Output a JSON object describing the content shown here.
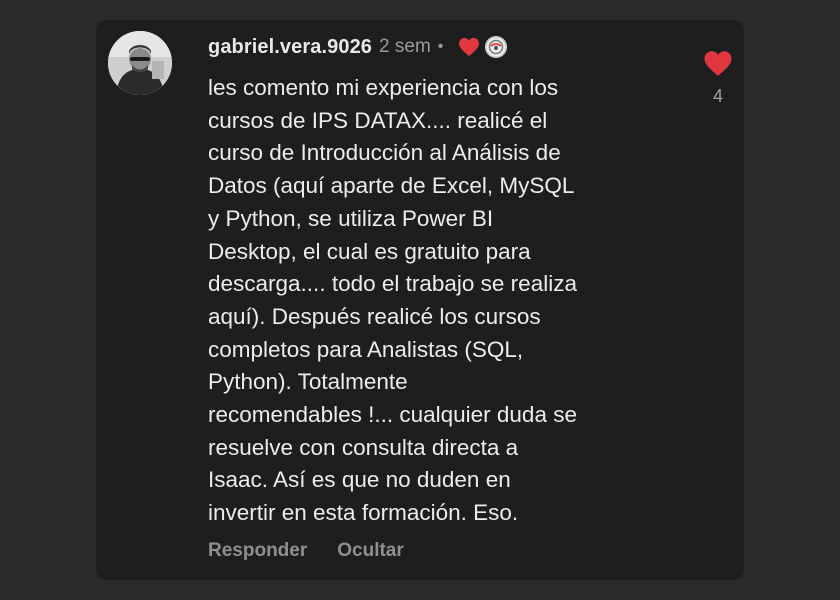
{
  "comment": {
    "username": "gabriel.vera.9026",
    "time_ago": "2 sem",
    "separator": "•",
    "avatar_icon": "user-avatar",
    "creator_liked_icon": "heart-icon",
    "creator_avatar_icon": "creator-avatar",
    "body_lines": [
      "les comento mi experiencia con los",
      "cursos de IPS DATAX.... realicé el",
      "curso de Introducción al Análisis de",
      "Datos (aquí aparte de Excel, MySQL",
      "y Python, se utiliza Power BI",
      "Desktop, el cual es gratuito para",
      "descarga.... todo el trabajo se realiza",
      "aquí). Después realicé los cursos",
      "completos para Analistas (SQL,",
      "Python). Totalmente",
      "recomendables !... cualquier duda se",
      "resuelve con consulta directa a",
      "Isaac. Así es que no duden en",
      "invertir en esta formación. Eso."
    ],
    "actions": {
      "reply_label": "Responder",
      "hide_label": "Ocultar"
    },
    "like": {
      "icon": "heart-icon",
      "count": "4",
      "color": "#e0383e"
    }
  }
}
